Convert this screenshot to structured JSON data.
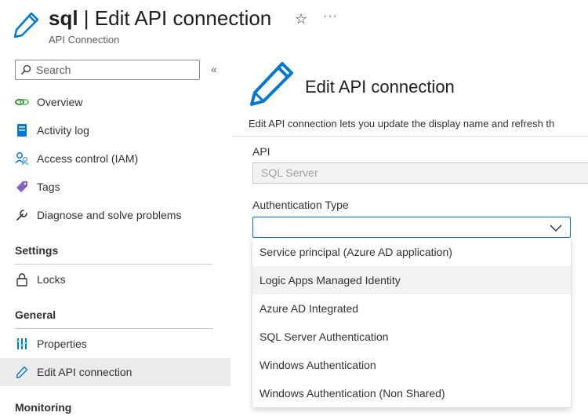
{
  "header": {
    "resource_name": "sql",
    "separator": " | ",
    "page_name": "Edit API connection",
    "subtitle": "API Connection",
    "favorite_icon": "star-icon",
    "more_label": "···"
  },
  "sidebar": {
    "search_placeholder": "Search",
    "collapse_label": "«",
    "items": [
      {
        "label": "Overview",
        "icon": "overview-icon"
      },
      {
        "label": "Activity log",
        "icon": "activity-log-icon"
      },
      {
        "label": "Access control (IAM)",
        "icon": "access-control-icon"
      },
      {
        "label": "Tags",
        "icon": "tag-icon"
      },
      {
        "label": "Diagnose and solve problems",
        "icon": "wrench-icon"
      }
    ],
    "settings": {
      "title": "Settings",
      "items": [
        {
          "label": "Locks",
          "icon": "lock-icon"
        }
      ]
    },
    "general": {
      "title": "General",
      "items": [
        {
          "label": "Properties",
          "icon": "properties-icon"
        },
        {
          "label": "Edit API connection",
          "icon": "pencil-icon"
        }
      ]
    },
    "monitoring": {
      "title": "Monitoring"
    }
  },
  "main": {
    "title": "Edit API connection",
    "description": "Edit API connection lets you update the display name and refresh th",
    "api_label": "API",
    "api_value": "SQL Server",
    "auth_label": "Authentication Type",
    "auth_value": "",
    "auth_options": [
      "Service principal (Azure AD application)",
      "Logic Apps Managed Identity",
      "Azure AD Integrated",
      "SQL Server Authentication",
      "Windows Authentication",
      "Windows Authentication (Non Shared)"
    ],
    "hovered_option_index": 1
  },
  "colors": {
    "accent": "#0078d4",
    "active_nav_bg": "#edebe9",
    "hover_option_bg": "#f3f2f1"
  }
}
